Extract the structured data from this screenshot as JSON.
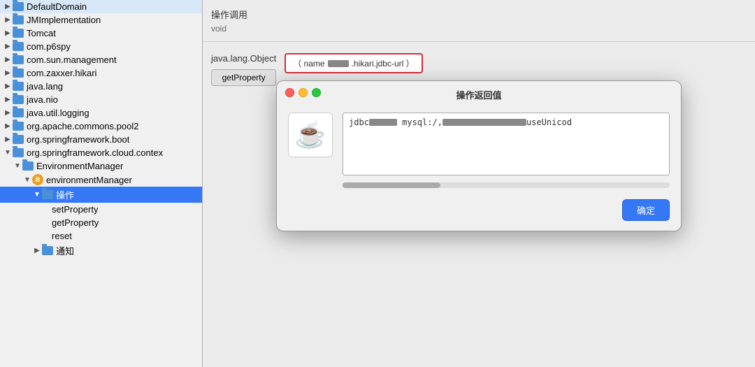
{
  "leftPanel": {
    "treeItems": [
      {
        "id": "defaultDomain",
        "label": "DefaultDomain",
        "indent": 0,
        "type": "folder",
        "arrow": "▶"
      },
      {
        "id": "jmImplementation",
        "label": "JMImplementation",
        "indent": 0,
        "type": "folder",
        "arrow": "▶"
      },
      {
        "id": "tomcat",
        "label": "Tomcat",
        "indent": 0,
        "type": "folder",
        "arrow": "▶"
      },
      {
        "id": "comp6spy",
        "label": "com.p6spy",
        "indent": 0,
        "type": "folder",
        "arrow": "▶"
      },
      {
        "id": "comSunManagement",
        "label": "com.sun.management",
        "indent": 0,
        "type": "folder",
        "arrow": "▶"
      },
      {
        "id": "comZaxxerHikari",
        "label": "com.zaxxer.hikari",
        "indent": 0,
        "type": "folder",
        "arrow": "▶"
      },
      {
        "id": "javaLang",
        "label": "java.lang",
        "indent": 0,
        "type": "folder",
        "arrow": "▶"
      },
      {
        "id": "javaNio",
        "label": "java.nio",
        "indent": 0,
        "type": "folder",
        "arrow": "▶"
      },
      {
        "id": "javaUtilLogging",
        "label": "java.util.logging",
        "indent": 0,
        "type": "folder",
        "arrow": "▶"
      },
      {
        "id": "orgApacheCommonsPool2",
        "label": "org.apache.commons.pool2",
        "indent": 0,
        "type": "folder",
        "arrow": "▶"
      },
      {
        "id": "orgSpringframeworkBoot",
        "label": "org.springframework.boot",
        "indent": 0,
        "type": "folder",
        "arrow": "▶"
      },
      {
        "id": "orgSpringframeworkCloudContex",
        "label": "org.springframework.cloud.contex",
        "indent": 0,
        "type": "folder",
        "arrow": "▼"
      },
      {
        "id": "environmentManager",
        "label": "EnvironmentManager",
        "indent": 1,
        "type": "folder",
        "arrow": "▼"
      },
      {
        "id": "environmentManagerBean",
        "label": "environmentManager",
        "indent": 2,
        "type": "bean",
        "arrow": "▼"
      },
      {
        "id": "caozuo",
        "label": "操作",
        "indent": 3,
        "type": "folder",
        "arrow": "▼",
        "selected": true
      },
      {
        "id": "setProperty",
        "label": "setProperty",
        "indent": 4,
        "type": "none",
        "arrow": ""
      },
      {
        "id": "getProperty",
        "label": "getProperty",
        "indent": 4,
        "type": "none",
        "arrow": ""
      },
      {
        "id": "reset",
        "label": "reset",
        "indent": 4,
        "type": "none",
        "arrow": ""
      },
      {
        "id": "tongzhi",
        "label": "通知",
        "indent": 3,
        "type": "folder",
        "arrow": "▶"
      }
    ]
  },
  "rightPanel": {
    "topBar": {
      "label": "操作调用",
      "value": "void"
    },
    "bottomRow": {
      "typeLabel": "java.lang.Object",
      "methodBtn": "getProperty",
      "paramsText": "（ name ",
      "censoredWidth": 30,
      "paramsText2": ".hikari.jdbc-url ）"
    }
  },
  "modal": {
    "title": "操作返回值",
    "trafficLights": [
      "red",
      "yellow",
      "green"
    ],
    "javaIconChar": "☕",
    "resultPrefix": "jdbc",
    "resultCensored1Width": 40,
    "resultText1": "mysql:/,",
    "resultCensored2Width": 120,
    "resultText2": "useUnicod",
    "confirmBtn": "确定"
  }
}
